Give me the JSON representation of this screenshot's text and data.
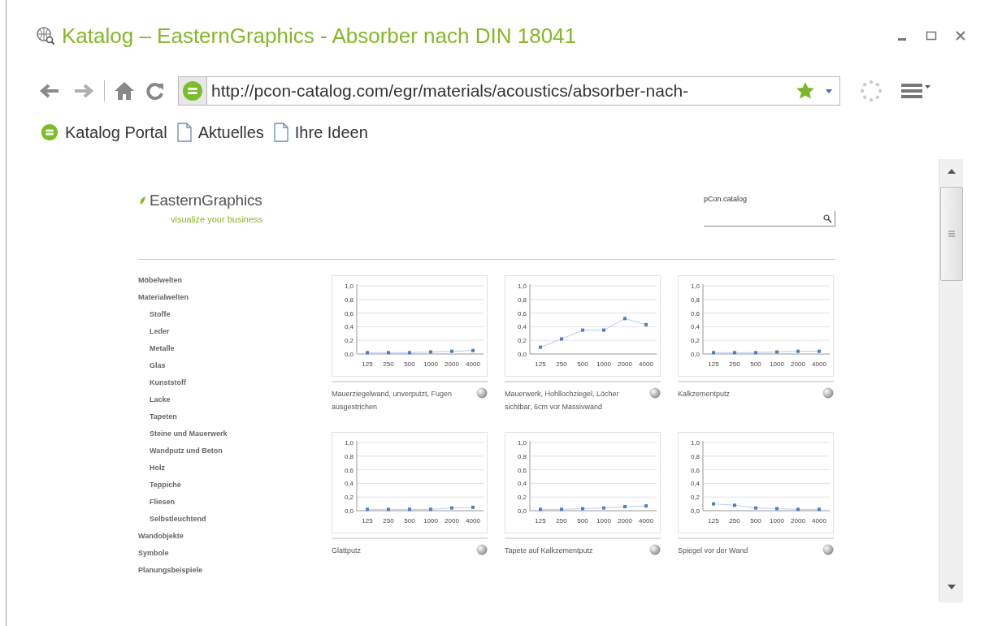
{
  "window": {
    "title": "Katalog – EasternGraphics - Absorber nach DIN 18041"
  },
  "toolbar": {
    "url": "http://pcon-catalog.com/egr/materials/acoustics/absorber-nach-"
  },
  "bookmarks": [
    {
      "label": "Katalog Portal",
      "kind": "portal"
    },
    {
      "label": "Aktuelles",
      "kind": "page"
    },
    {
      "label": "Ihre Ideen",
      "kind": "page"
    }
  ],
  "page": {
    "logo": {
      "name": "EasternGraphics",
      "tagline": "visualize your business"
    },
    "search": {
      "label": "pCon.catalog"
    },
    "sidebar": {
      "items": [
        {
          "label": "Möbelwelten"
        },
        {
          "label": "Materialwelten",
          "children": [
            {
              "label": "Stoffe"
            },
            {
              "label": "Leder"
            },
            {
              "label": "Metalle"
            },
            {
              "label": "Glas"
            },
            {
              "label": "Kunststoff"
            },
            {
              "label": "Lacke"
            },
            {
              "label": "Tapeten"
            },
            {
              "label": "Steine und Mauerwerk"
            },
            {
              "label": "Wandputz und Beton"
            },
            {
              "label": "Holz"
            },
            {
              "label": "Teppiche"
            },
            {
              "label": "Fliesen"
            },
            {
              "label": "Selbstleuchtend"
            }
          ]
        },
        {
          "label": "Wandobjekte"
        },
        {
          "label": "Symbole"
        },
        {
          "label": "Planungsbeispiele"
        }
      ]
    },
    "materials": [
      {
        "caption": "Mauerziegelwand, unverputzt, Fugen ausgestrichen",
        "chart_data": {
          "type": "line",
          "categories": [
            "125",
            "250",
            "500",
            "1000",
            "2000",
            "4000"
          ],
          "grid": true,
          "series": [
            {
              "color": "#4f81bd",
              "marker": "square",
              "values": [
                0.02,
                0.02,
                0.02,
                0.03,
                0.04,
                0.05
              ]
            }
          ],
          "ylim": [
            0,
            1
          ],
          "yticks": [
            {
              "value": 0,
              "label": "0,0"
            },
            {
              "value": 0.2,
              "label": "0,2"
            },
            {
              "value": 0.4,
              "label": "0,4"
            },
            {
              "value": 0.6,
              "label": "0,6"
            },
            {
              "value": 0.8,
              "label": "0,8"
            },
            {
              "value": 1,
              "label": "1,0"
            }
          ]
        }
      },
      {
        "caption": "Mauerwerk, Hohllochziegel, Löcher sichtbar, 6cm vor Massivwand",
        "chart_data": {
          "type": "line",
          "categories": [
            "125",
            "250",
            "500",
            "1000",
            "2000",
            "4000"
          ],
          "grid": true,
          "series": [
            {
              "color": "#4f81bd",
              "marker": "square",
              "values": [
                0.1,
                0.22,
                0.35,
                0.35,
                0.52,
                0.43
              ]
            }
          ],
          "ylim": [
            0,
            1
          ],
          "yticks": [
            {
              "value": 0,
              "label": "0,0"
            },
            {
              "value": 0.2,
              "label": "0,2"
            },
            {
              "value": 0.4,
              "label": "0,4"
            },
            {
              "value": 0.6,
              "label": "0,6"
            },
            {
              "value": 0.8,
              "label": "0,8"
            },
            {
              "value": 1,
              "label": "1,0"
            }
          ]
        }
      },
      {
        "caption": "Kalkzementputz",
        "chart_data": {
          "type": "line",
          "categories": [
            "125",
            "250",
            "500",
            "1000",
            "2000",
            "4000"
          ],
          "grid": true,
          "series": [
            {
              "color": "#4f81bd",
              "marker": "square",
              "values": [
                0.02,
                0.02,
                0.02,
                0.03,
                0.04,
                0.04
              ]
            }
          ],
          "ylim": [
            0,
            1
          ],
          "yticks": [
            {
              "value": 0,
              "label": "0,0"
            },
            {
              "value": 0.2,
              "label": "0,2"
            },
            {
              "value": 0.4,
              "label": "0,4"
            },
            {
              "value": 0.6,
              "label": "0,6"
            },
            {
              "value": 0.8,
              "label": "0,8"
            },
            {
              "value": 1,
              "label": "1,0"
            }
          ]
        }
      },
      {
        "caption": "Glattputz",
        "chart_data": {
          "type": "line",
          "categories": [
            "125",
            "250",
            "500",
            "1000",
            "2000",
            "4000"
          ],
          "grid": true,
          "series": [
            {
              "color": "#4f81bd",
              "marker": "square",
              "values": [
                0.02,
                0.02,
                0.02,
                0.02,
                0.04,
                0.05
              ]
            }
          ],
          "ylim": [
            0,
            1
          ],
          "yticks": [
            {
              "value": 0,
              "label": "0,0"
            },
            {
              "value": 0.2,
              "label": "0,2"
            },
            {
              "value": 0.4,
              "label": "0,4"
            },
            {
              "value": 0.6,
              "label": "0,6"
            },
            {
              "value": 0.8,
              "label": "0,8"
            },
            {
              "value": 1,
              "label": "1,0"
            }
          ]
        }
      },
      {
        "caption": "Tapete auf Kalkzementputz",
        "chart_data": {
          "type": "line",
          "categories": [
            "125",
            "250",
            "500",
            "1000",
            "2000",
            "4000"
          ],
          "grid": true,
          "series": [
            {
              "color": "#4f81bd",
              "marker": "square",
              "values": [
                0.02,
                0.02,
                0.03,
                0.04,
                0.06,
                0.07
              ]
            }
          ],
          "ylim": [
            0,
            1
          ],
          "yticks": [
            {
              "value": 0,
              "label": "0,0"
            },
            {
              "value": 0.2,
              "label": "0,2"
            },
            {
              "value": 0.4,
              "label": "0,4"
            },
            {
              "value": 0.6,
              "label": "0,6"
            },
            {
              "value": 0.8,
              "label": "0,8"
            },
            {
              "value": 1,
              "label": "1,0"
            }
          ]
        }
      },
      {
        "caption": "Spiegel vor der Wand",
        "chart_data": {
          "type": "line",
          "categories": [
            "125",
            "250",
            "500",
            "1000",
            "2000",
            "4000"
          ],
          "grid": true,
          "series": [
            {
              "color": "#4f81bd",
              "marker": "square",
              "values": [
                0.1,
                0.08,
                0.04,
                0.03,
                0.02,
                0.02
              ]
            }
          ],
          "ylim": [
            0,
            1
          ],
          "yticks": [
            {
              "value": 0,
              "label": "0,0"
            },
            {
              "value": 0.2,
              "label": "0,2"
            },
            {
              "value": 0.4,
              "label": "0,4"
            },
            {
              "value": 0.6,
              "label": "0,6"
            },
            {
              "value": 0.8,
              "label": "0,8"
            },
            {
              "value": 1,
              "label": "1,0"
            }
          ]
        }
      }
    ]
  }
}
